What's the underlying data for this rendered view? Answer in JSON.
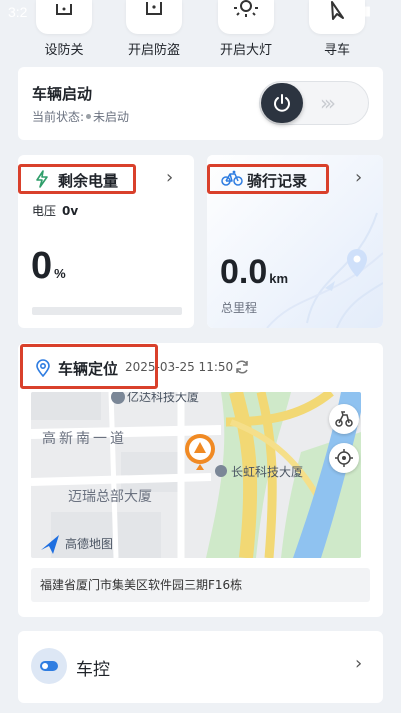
{
  "status_bar": {
    "time": "3:2"
  },
  "quick_actions": [
    {
      "label": "设防关",
      "icon": "lock-icon"
    },
    {
      "label": "开启防盗",
      "icon": "anti-theft-icon"
    },
    {
      "label": "开启大灯",
      "icon": "headlight-icon"
    },
    {
      "label": "寻车",
      "icon": "locate-arrow-icon"
    }
  ],
  "vehicle_start": {
    "title": "车辆启动",
    "status_label": "当前状态:",
    "status_value": "未启动",
    "switch_state": "off"
  },
  "battery": {
    "title": "剩余电量",
    "voltage_label": "电压",
    "voltage_value": "0v",
    "percent_value": "0",
    "percent_unit": "%",
    "level": 0
  },
  "ride_record": {
    "title": "骑行记录",
    "mileage_value": "0.0",
    "mileage_unit": "km",
    "mileage_label": "总里程"
  },
  "location": {
    "title": "车辆定位",
    "timestamp": "2025-03-25 11:50",
    "address": "福建省厦门市集美区软件园三期F16栋",
    "map_labels": {
      "poi_top": "亿达科技大厦",
      "road": "高新南一道",
      "poi_right": "长虹科技大厦",
      "poi_left": "迈瑞总部大厦",
      "brand": "高德地图"
    }
  },
  "vehicle_control": {
    "label": "车控"
  },
  "colors": {
    "highlight": "#d9402b",
    "battery_green": "#2f9e6a",
    "brand_blue": "#2f7de1"
  }
}
